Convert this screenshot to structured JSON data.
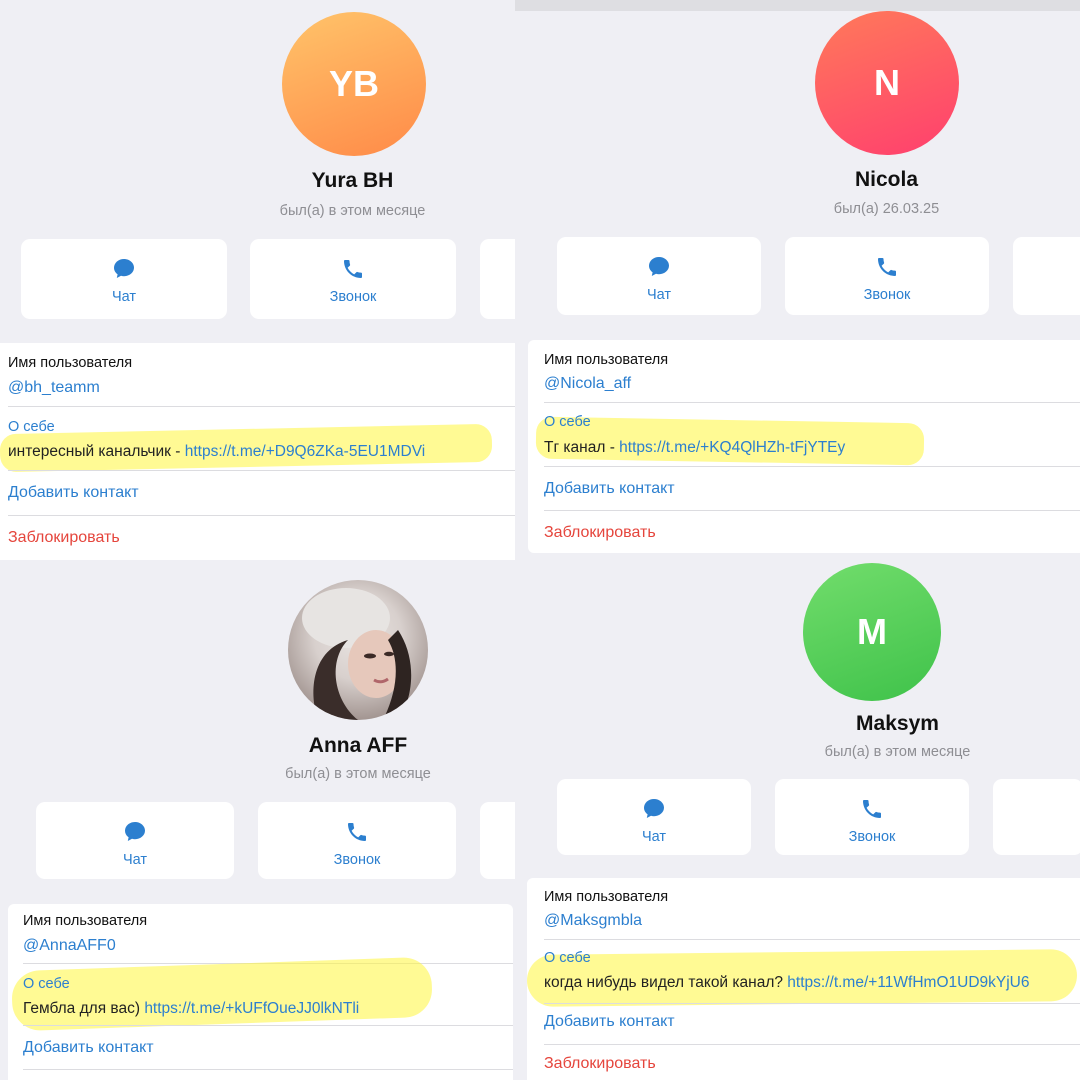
{
  "profiles": [
    {
      "initials": "YB",
      "name": "Yura BH",
      "status": "был(а) в этом месяце",
      "chat_label": "Чат",
      "call_label": "Звонок",
      "username_title": "Имя пользователя",
      "username": "@bh_teamm",
      "about_title": "О себе",
      "bio_text": "интересный канальчик - ",
      "bio_link": "https://t.me/+D9Q6ZKa-5EU1MDVi",
      "add_contact": "Добавить контакт",
      "block": "Заблокировать"
    },
    {
      "initials": "N",
      "name": "Nicola",
      "status": "был(а) 26.03.25",
      "chat_label": "Чат",
      "call_label": "Звонок",
      "username_title": "Имя пользователя",
      "username": "@Nicola_aff",
      "about_title": "О себе",
      "bio_text": "Тг канал - ",
      "bio_link": "https://t.me/+KQ4QlHZh-tFjYTEy",
      "add_contact": "Добавить контакт",
      "block": "Заблокировать"
    },
    {
      "initials": "",
      "name": "Anna AFF",
      "status": "был(а) в этом месяце",
      "chat_label": "Чат",
      "call_label": "Звонок",
      "username_title": "Имя пользователя",
      "username": "@AnnaAFF0",
      "about_title": "О себе",
      "bio_text": "Гембла для вас) ",
      "bio_link": "https://t.me/+kUFfOueJJ0lkNTli",
      "add_contact": "Добавить контакт",
      "block": ""
    },
    {
      "initials": "M",
      "name": "Maksym",
      "status": "был(а) в этом месяце",
      "chat_label": "Чат",
      "call_label": "Звонок",
      "username_title": "Имя пользователя",
      "username": "@Maksgmbla",
      "about_title": "О себе",
      "bio_text": "когда нибудь видел такой канал? ",
      "bio_link": "https://t.me/+11WfHmO1UD9kYjU6",
      "add_contact": "Добавить контакт",
      "block": "Заблокировать"
    }
  ],
  "icons": {
    "chat": "chat-bubble-icon",
    "call": "phone-icon",
    "photo": "profile-photo"
  },
  "colors": {
    "accent_blue": "#2c7fcf",
    "block_red": "#e5453c",
    "highlight": "#fff53c",
    "avatar_orange": "#ffa25a",
    "avatar_red": "#ff5f63",
    "avatar_green": "#54d35a"
  }
}
